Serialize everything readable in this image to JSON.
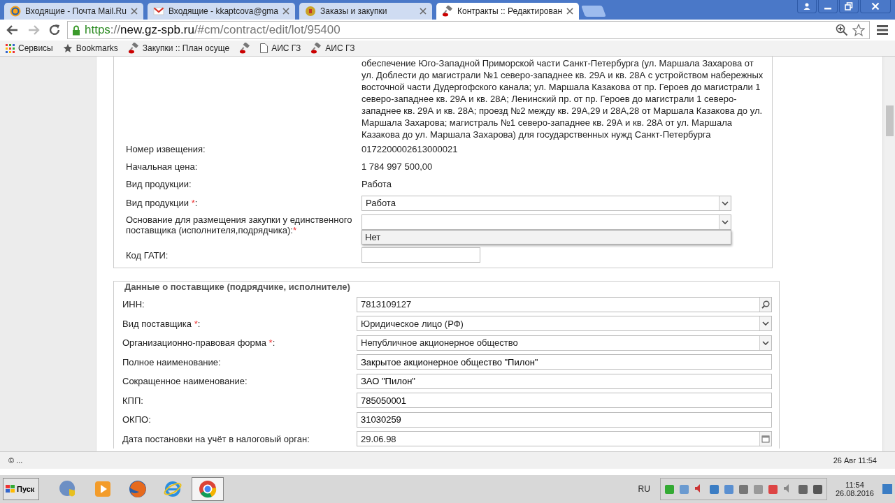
{
  "browser": {
    "tabs": [
      {
        "title": "Входящие - Почта Mail.Ru",
        "selected": false
      },
      {
        "title": "Входящие - kkaptcova@gma",
        "selected": false
      },
      {
        "title": "Заказы и закупки",
        "selected": false
      },
      {
        "title": "Контракты :: Редактирован",
        "selected": true
      }
    ],
    "address": {
      "scheme": "https",
      "separator": "://",
      "host": "new.gz-spb.ru",
      "path": "/#cm/contract/edit/lot/95400"
    },
    "bookmarks": [
      {
        "kind": "link",
        "label": "Сервисы"
      },
      {
        "kind": "link",
        "label": "Bookmarks"
      },
      {
        "kind": "link",
        "label": "Закупки :: План осуще"
      },
      {
        "kind": "icon_only"
      },
      {
        "kind": "link",
        "label": "АИС ГЗ"
      },
      {
        "kind": "link",
        "label": "АИС ГЗ"
      }
    ]
  },
  "lot_section": {
    "description": "обеспечение Юго-Западной Приморской части Санкт-Петербурга (ул. Маршала Захарова от ул. Доблести до магистрали №1 северо-западнее кв. 29А и кв. 28А с устройством набережных восточной части Дудергофского канала; ул. Маршала Казакова от пр. Героев до магистрали 1 северо-западнее кв. 29А и кв. 28А; Ленинский пр. от пр. Героев до магистрали 1 северо-западнее кв. 29А и кв. 28А; проезд №2 между кв. 29А,29 и 28А,28 от Маршала Казакова до ул. Маршала Захарова; магистраль №1 северо-западнее кв. 29А и кв. 28А от ул. Маршала Казакова до ул. Маршала Захарова) для государственных нужд Санкт-Петербурга",
    "fields": [
      {
        "kind": "text",
        "label": "Номер извещения:",
        "value": "0172200002613000021"
      },
      {
        "kind": "text",
        "label": "Начальная цена:",
        "value": "1 784 997 500,00"
      },
      {
        "kind": "text",
        "label": "Вид продукции:",
        "value": "Работа"
      },
      {
        "kind": "select",
        "label": "Вид продукции ",
        "required_mark": "*",
        "after": ":",
        "value": "Работа"
      },
      {
        "kind": "select_open",
        "label": "Основание для размещения закупки у единственного поставщика (исполнителя,подрядчика):",
        "required_mark": "*",
        "options": [
          "Нет"
        ]
      },
      {
        "kind": "input",
        "label": "Код ГАТИ:"
      }
    ]
  },
  "supplier_section": {
    "legend": "Данные о поставщике (подрядчике, исполнителе)",
    "fields": [
      {
        "kind": "search",
        "label": "ИНН:",
        "value": "7813109127"
      },
      {
        "kind": "select",
        "label": "Вид поставщика ",
        "required_mark": "*",
        "after": ":",
        "value": "Юридическое лицо (РФ)"
      },
      {
        "kind": "select",
        "label": "Организационно-правовая форма ",
        "required_mark": "*",
        "after": ":",
        "value": "Непубличное акционерное общество"
      },
      {
        "kind": "input",
        "label": "Полное наименование:",
        "value": "Закрытое акционерное общество \"Пилон\""
      },
      {
        "kind": "input",
        "label": "Сокращенное наименование:",
        "value": "ЗАО \"Пилон\""
      },
      {
        "kind": "input",
        "label": "КПП:",
        "value": "785050001"
      },
      {
        "kind": "input",
        "label": "ОКПО:",
        "value": "31030259"
      },
      {
        "kind": "date",
        "label": "Дата постановки на учёт в налоговый орган:",
        "value": "29.06.98"
      }
    ]
  },
  "status_bar": {
    "left": "© ...",
    "right": "26 Авг 11:54"
  },
  "taskbar": {
    "start": "Пуск",
    "apps": [
      {
        "selected": false
      },
      {
        "selected": false
      },
      {
        "selected": false
      },
      {
        "selected": false
      },
      {
        "selected": true
      }
    ],
    "language": "RU",
    "time": "11:54",
    "date": "26.08.2016"
  }
}
